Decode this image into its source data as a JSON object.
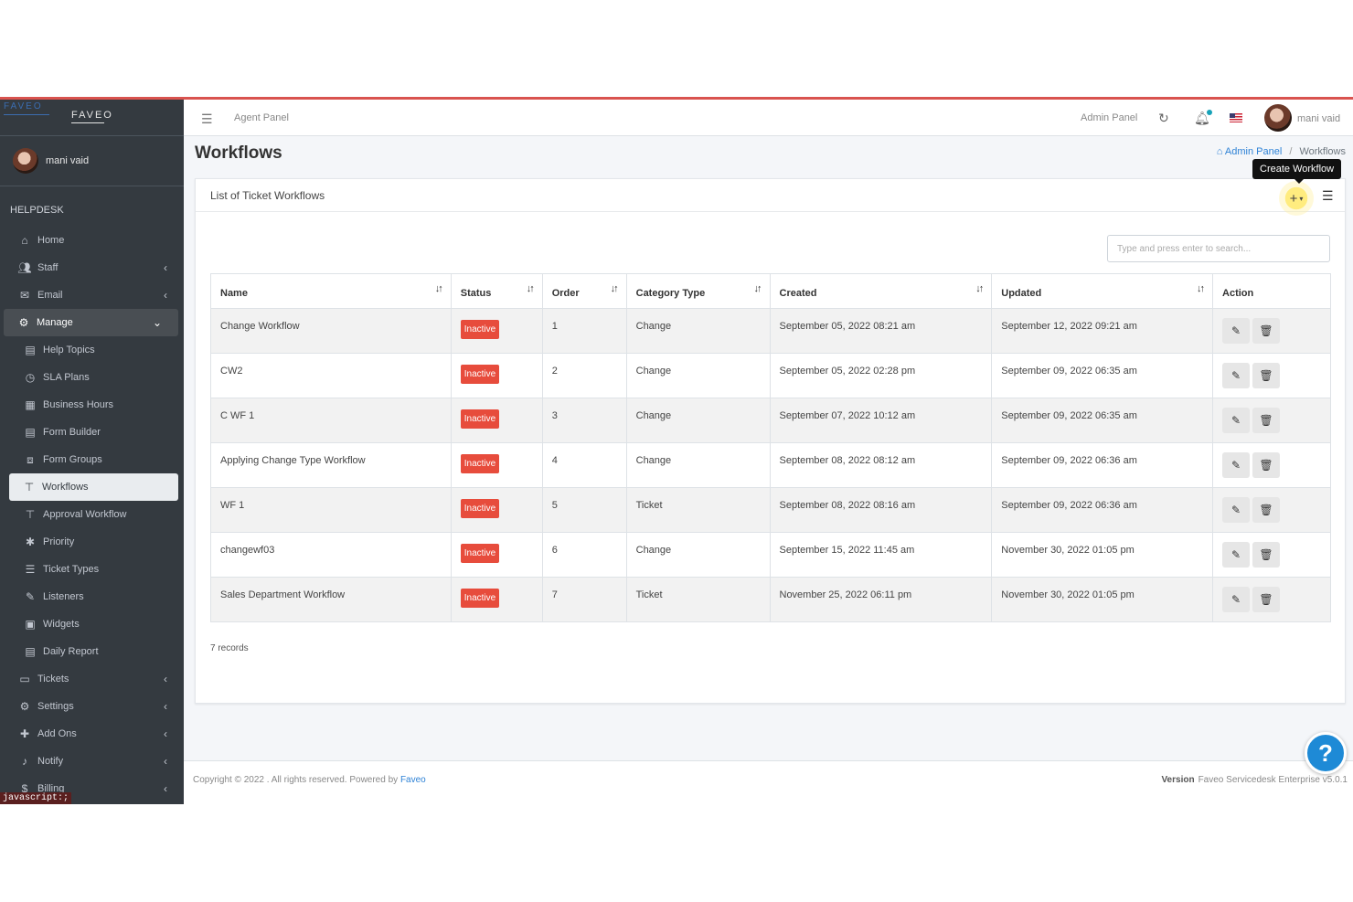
{
  "brand": {
    "logo": "FAVEO",
    "logo_faint": "FAVEO"
  },
  "user": {
    "name": "mani vaid"
  },
  "sidebar": {
    "section": "HELPDESK",
    "items": [
      {
        "label": "Home",
        "icon": "home-icon"
      },
      {
        "label": "Staff",
        "icon": "users-icon"
      },
      {
        "label": "Email",
        "icon": "envelope-icon"
      },
      {
        "label": "Manage",
        "icon": "cogs-icon"
      },
      {
        "label": "Help Topics",
        "icon": "file-icon"
      },
      {
        "label": "SLA Plans",
        "icon": "clock-icon"
      },
      {
        "label": "Business Hours",
        "icon": "calendar-icon"
      },
      {
        "label": "Form Builder",
        "icon": "file-icon"
      },
      {
        "label": "Form Groups",
        "icon": "object-group-icon"
      },
      {
        "label": "Workflows",
        "icon": "sitemap-icon"
      },
      {
        "label": "Approval Workflow",
        "icon": "sitemap-icon"
      },
      {
        "label": "Priority",
        "icon": "asterisk-icon"
      },
      {
        "label": "Ticket Types",
        "icon": "list-icon"
      },
      {
        "label": "Listeners",
        "icon": "magic-icon"
      },
      {
        "label": "Widgets",
        "icon": "widget-icon"
      },
      {
        "label": "Daily Report",
        "icon": "file-icon"
      },
      {
        "label": "Tickets",
        "icon": "tickets-icon"
      },
      {
        "label": "Settings",
        "icon": "gear-icon"
      },
      {
        "label": "Add Ons",
        "icon": "puzzle-icon"
      },
      {
        "label": "Notify",
        "icon": "bell-icon"
      },
      {
        "label": "Billing",
        "icon": "dollar-icon"
      }
    ],
    "status_text": "javascript:;"
  },
  "header": {
    "agent_panel": "Agent Panel",
    "admin_panel": "Admin Panel",
    "user_name": "mani vaid"
  },
  "page": {
    "title": "Workflows",
    "breadcrumb": {
      "home": "Admin Panel",
      "current": "Workflows"
    },
    "tooltip": "Create Workflow"
  },
  "card": {
    "title": "List of Ticket Workflows",
    "search_placeholder": "Type and press enter to search...",
    "columns": [
      "Name",
      "Status",
      "Order",
      "Category Type",
      "Created",
      "Updated",
      "Action"
    ],
    "rows": [
      {
        "name": "Change Workflow",
        "status": "Inactive",
        "order": "1",
        "category": "Change",
        "created": "September 05, 2022 08:21 am",
        "updated": "September 12, 2022 09:21 am"
      },
      {
        "name": "CW2",
        "status": "Inactive",
        "order": "2",
        "category": "Change",
        "created": "September 05, 2022 02:28 pm",
        "updated": "September 09, 2022 06:35 am"
      },
      {
        "name": "C WF 1",
        "status": "Inactive",
        "order": "3",
        "category": "Change",
        "created": "September 07, 2022 10:12 am",
        "updated": "September 09, 2022 06:35 am"
      },
      {
        "name": "Applying Change Type Workflow",
        "status": "Inactive",
        "order": "4",
        "category": "Change",
        "created": "September 08, 2022 08:12 am",
        "updated": "September 09, 2022 06:36 am"
      },
      {
        "name": "WF 1",
        "status": "Inactive",
        "order": "5",
        "category": "Ticket",
        "created": "September 08, 2022 08:16 am",
        "updated": "September 09, 2022 06:36 am"
      },
      {
        "name": "changewf03",
        "status": "Inactive",
        "order": "6",
        "category": "Change",
        "created": "September 15, 2022 11:45 am",
        "updated": "November 30, 2022 01:05 pm"
      },
      {
        "name": "Sales Department Workflow",
        "status": "Inactive",
        "order": "7",
        "category": "Ticket",
        "created": "November 25, 2022 06:11 pm",
        "updated": "November 30, 2022 01:05 pm"
      }
    ],
    "records": "7 records"
  },
  "footer": {
    "copyright": "Copyright © 2022 . All rights reserved. Powered by",
    "powered_link": "Faveo",
    "version_label": "Version",
    "version_value": "Faveo Servicedesk Enterprise v5.0.1"
  },
  "colors": {
    "sidebar": "#343a40",
    "accent_red": "#d9534f",
    "badge_inactive": "#e74c3c",
    "link": "#2e82d6",
    "help": "#1e8ad6"
  }
}
